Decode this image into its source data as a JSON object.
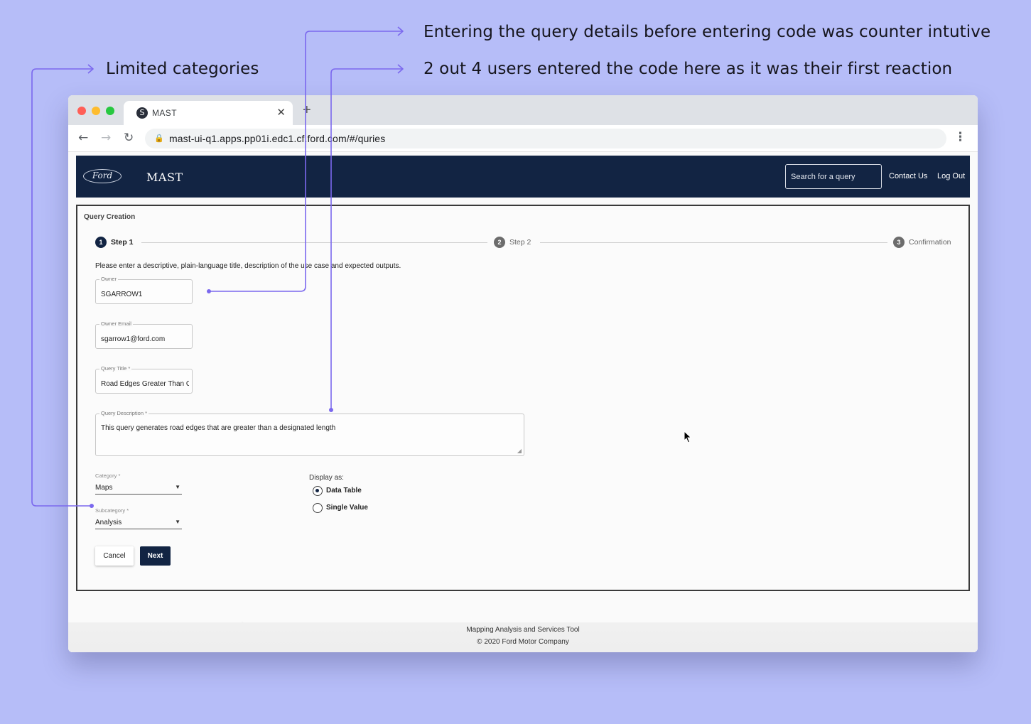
{
  "annotations": {
    "counter_intuitive": "Entering the query details before entering code was counter intutive",
    "first_reaction": "2 out 4 users entered the code here as it was their first reaction",
    "limited_categories": "Limited categories",
    "accent_color": "#7b68ee"
  },
  "browser": {
    "tab_title": "MAST",
    "url": "mast-ui-q1.apps.pp01i.edc1.cf.ford.com/#/quries"
  },
  "header": {
    "logo_text": "Ford",
    "app_title": "MAST",
    "search_placeholder": "Search for a query",
    "contact_label": "Contact Us",
    "logout_label": "Log Out",
    "brand_color": "#122443"
  },
  "form": {
    "title": "Query Creation",
    "steps": [
      {
        "number": "1",
        "label": "Step 1"
      },
      {
        "number": "2",
        "label": "Step 2"
      },
      {
        "number": "3",
        "label": "Confirmation"
      }
    ],
    "instructions": "Please enter a descriptive, plain-language title, description of the use case and expected outputs.",
    "owner": {
      "label": "Owner",
      "value": "SGARROW1"
    },
    "owner_email": {
      "label": "Owner Email",
      "value": "sgarrow1@ford.com"
    },
    "query_title": {
      "label": "Query Title *",
      "value": "Road Edges Greater Than C"
    },
    "query_description": {
      "label": "Query Description *",
      "value": "This query generates road edges that are greater than a designated length"
    },
    "category": {
      "label": "Category *",
      "value": "Maps"
    },
    "subcategory": {
      "label": "Subcategory *",
      "value": "Analysis"
    },
    "display_as": {
      "label": "Display as:",
      "options": [
        "Data Table",
        "Single Value"
      ],
      "selected": "Data Table"
    },
    "cancel_label": "Cancel",
    "next_label": "Next"
  },
  "footer": {
    "line1": "Mapping Analysis and Services Tool",
    "line2": "© 2020 Ford Motor Company"
  }
}
